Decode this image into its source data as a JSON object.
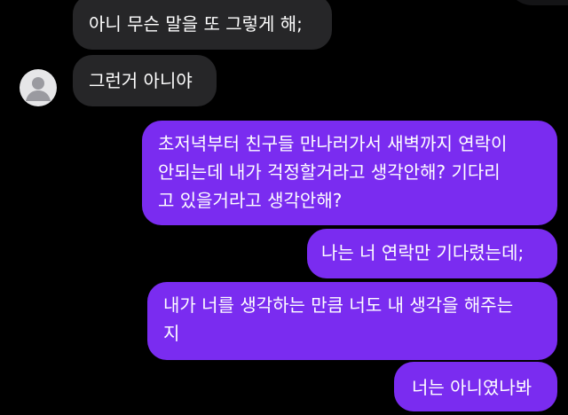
{
  "chat": {
    "messages": [
      {
        "direction": "incoming",
        "text": "아니 무슨 말을 또 그렇게 해;"
      },
      {
        "direction": "incoming",
        "text": "그런거 아니야"
      },
      {
        "direction": "outgoing",
        "text": "초저녁부터 친구들 만나러가서 새벽까지 연락이\n안되는데 내가 걱정할거라고 생각안해? 기다리\n고 있을거라고 생각안해?"
      },
      {
        "direction": "outgoing",
        "text": "나는 너 연락만 기다렸는데;"
      },
      {
        "direction": "outgoing",
        "text": "내가 너를 생각하는 만큼 너도 내 생각을 해주는\n지"
      },
      {
        "direction": "outgoing",
        "text": "너는 아니였나봐"
      }
    ]
  },
  "colors": {
    "background": "#000000",
    "incoming_bubble": "#262628",
    "outgoing_bubble": "#7a2cf0",
    "text": "#ffffff",
    "avatar_bg": "#e6e6e8",
    "avatar_figure": "#9a9aa0"
  },
  "icons": {
    "avatar": "default-user-avatar-icon"
  }
}
